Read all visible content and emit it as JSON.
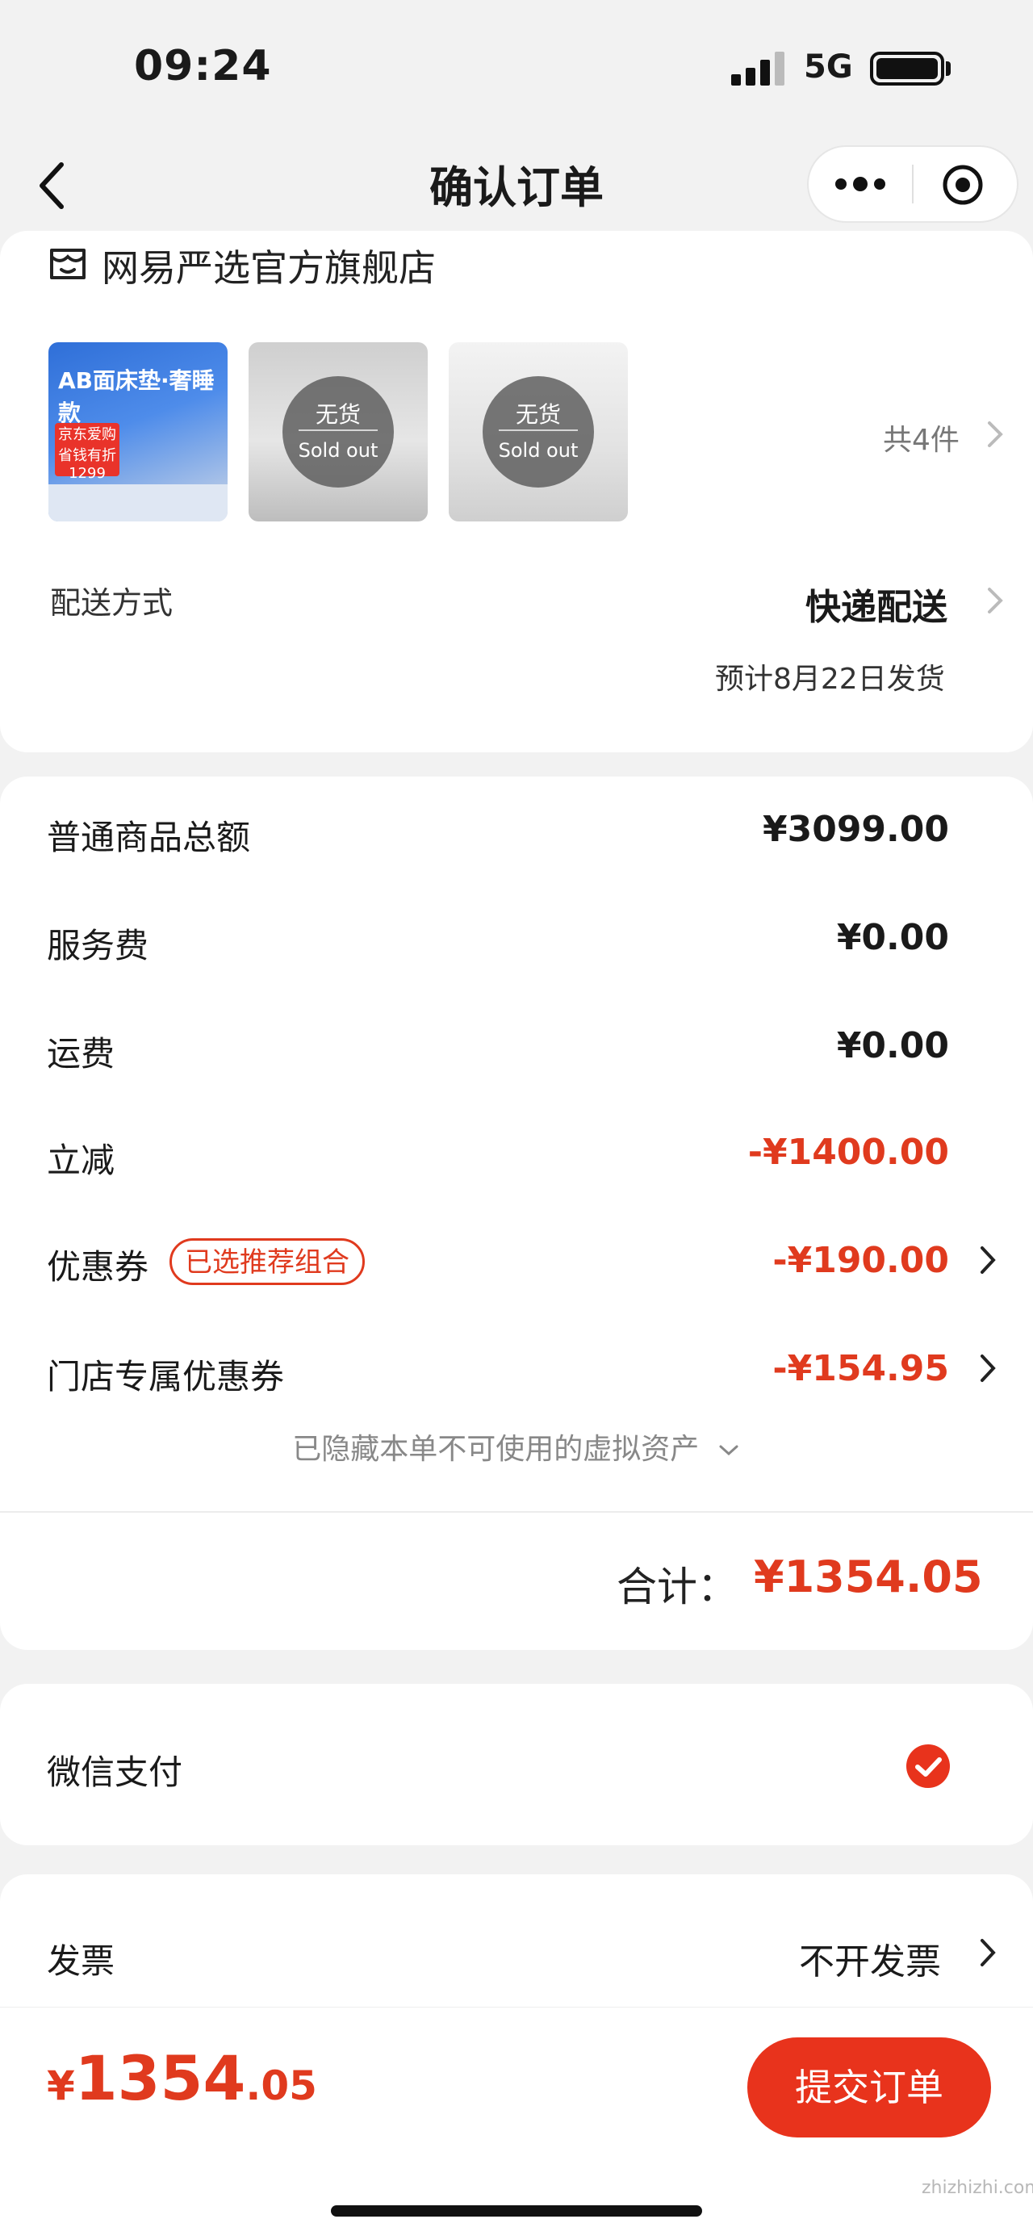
{
  "status": {
    "time": "09:24",
    "network": "5G"
  },
  "nav": {
    "title": "确认订单"
  },
  "store": {
    "name": "网易严选官方旗舰店",
    "thumb1": {
      "top_text": "AB面床垫·奢睡款",
      "badge": "京东爱购 省钱有折 1299"
    },
    "soldout_cn": "无货",
    "soldout_en": "Sold out",
    "count": "共4件"
  },
  "delivery": {
    "label": "配送方式",
    "value": "快递配送",
    "ship_date": "预计8月22日发货"
  },
  "fees": {
    "goods_total_label": "普通商品总额",
    "goods_total": "¥3099.00",
    "service_label": "服务费",
    "service": "¥0.00",
    "shipping_label": "运费",
    "shipping": "¥0.00",
    "discount_label": "立减",
    "discount": "-¥1400.00",
    "coupon_label": "优惠券",
    "coupon_tag": "已选推荐组合",
    "coupon": "-¥190.00",
    "store_coupon_label": "门店专属优惠券",
    "store_coupon": "-¥154.95",
    "hidden_note": "已隐藏本单不可使用的虚拟资产",
    "total_label": "合计：",
    "total": "¥1354.05"
  },
  "payment": {
    "label": "微信支付"
  },
  "invoice": {
    "label": "发票",
    "value": "不开发票"
  },
  "footer": {
    "currency": "¥",
    "price_int": "1354",
    "price_dec": ".05",
    "submit": "提交订单"
  },
  "watermark": "zhizhizhi.com",
  "colors": {
    "accent": "#e03a1e",
    "button": "#e8331c",
    "background": "#f2f2f2"
  }
}
